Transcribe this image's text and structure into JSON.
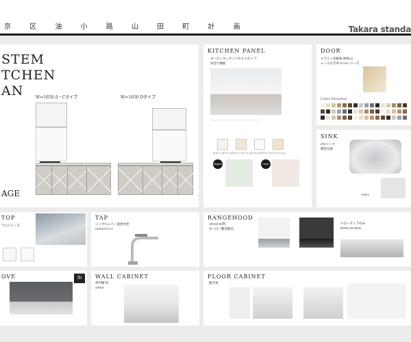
{
  "header": {
    "title": "京 区 油 小 路 山 田 町 計 画",
    "brand": "Takara standa"
  },
  "main": {
    "title_lines": [
      "STEM",
      "TCHEN",
      "AN"
    ],
    "label_left": "W=1650 A・Cタイプ",
    "label_right": "W=1650 Dタイプ",
    "bottom": "AGE"
  },
  "kitchen_panel": {
    "title": "KITCHEN PANEL",
    "line1": "ホーローキッチンパネル Hタイプ",
    "line2": "水切り機能",
    "colors": [
      "ロマシュホワイト",
      "ロマシュベージュ",
      "マイルドホワイト",
      "ライトベージュ"
    ],
    "dot1": "Magnet",
    "dot2": "Clean"
  },
  "door": {
    "title": "DOOR",
    "line1": "メラミン化粧板 扉色LS",
    "line2": "レール引き手 PA-Bシリーズ",
    "variation": "Color Variation"
  },
  "sink": {
    "title": "SINK",
    "line1": "ZIGシンク",
    "line2": "静音仕様",
    "dim": "53cm"
  },
  "top": {
    "title": "TOP",
    "line1": "ラルシリーズ"
  },
  "tap": {
    "title": "TAP",
    "line1": "シングルレバー混合水栓",
    "line2": "KKSS7U-1-T"
  },
  "rangehood": {
    "title": "RANGEHOOD",
    "line1": "VRAM-90円",
    "line2": "ホーロー整流板付",
    "line3": "※ロータイプのみ",
    "line4": "BFRS-3G-901L"
  },
  "stove": {
    "title": "OVE"
  },
  "wall_cabinet": {
    "title": "WALL CABINET",
    "line1": "吊戸棚 有",
    "line2": "OPEN"
  },
  "floor_cabinet": {
    "title": "FLOOR CABINET",
    "line1": "開き扉"
  }
}
